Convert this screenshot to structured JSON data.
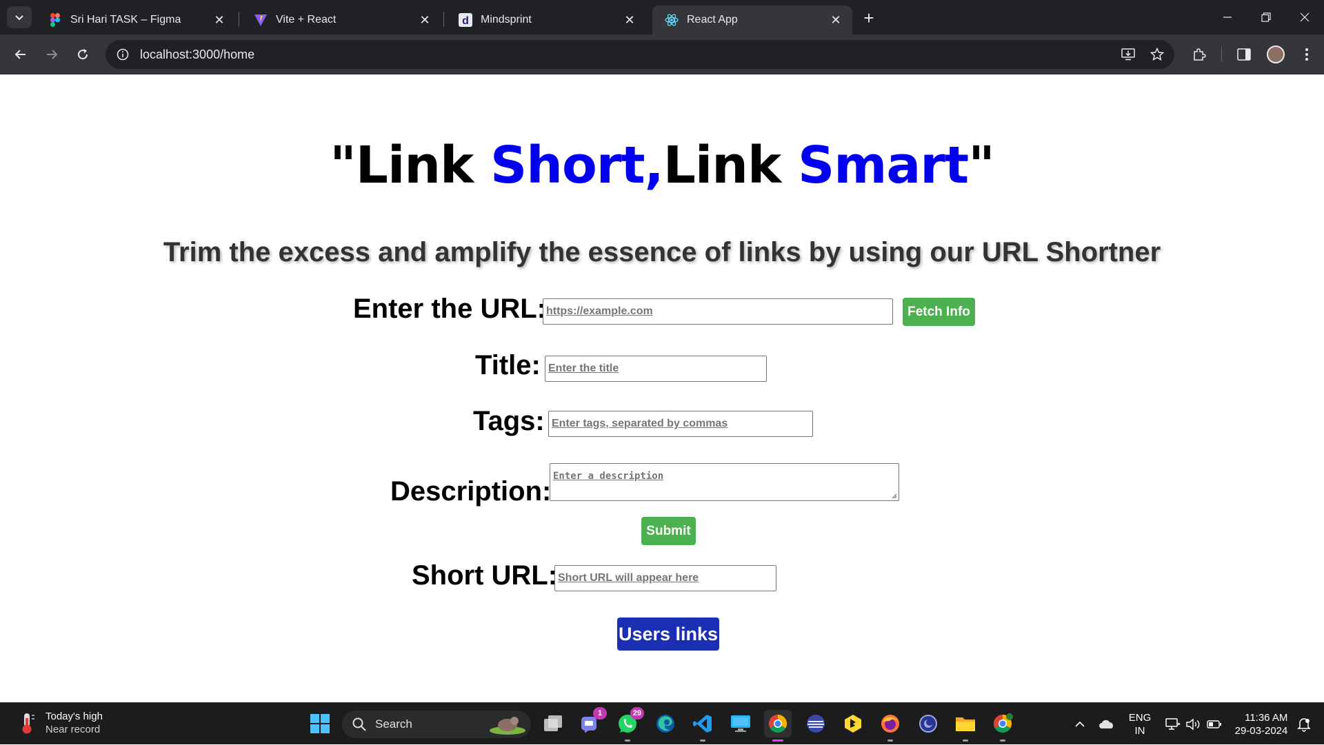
{
  "browser": {
    "tabs": [
      {
        "title": "Sri Hari TASK – Figma",
        "icon": "figma-icon",
        "active": false
      },
      {
        "title": "Vite + React",
        "icon": "vite-icon",
        "active": false
      },
      {
        "title": "Mindsprint",
        "icon": "mindsprint-icon",
        "active": false
      },
      {
        "title": "React App",
        "icon": "react-icon",
        "active": true
      }
    ],
    "address": "localhost:3000/home"
  },
  "page": {
    "headline": {
      "part1": "\"Link ",
      "part2": "Short,",
      "part3": "Link ",
      "part4": "Smart",
      "part5": "\""
    },
    "subheading": "Trim the excess and amplify the essence of links by using our URL Shortner",
    "form": {
      "url_label": "Enter the URL:",
      "url_placeholder": "https://example.com",
      "fetch_button": "Fetch Info",
      "title_label": "Title:",
      "title_placeholder": "Enter the title",
      "tags_label": "Tags:",
      "tags_placeholder": "Enter tags, separated by commas",
      "description_label": "Description:",
      "description_placeholder": "Enter a description",
      "submit_button": "Submit",
      "short_url_label": "Short URL:",
      "short_url_placeholder": "Short URL will appear here",
      "users_links_button": "Users links"
    },
    "colors": {
      "accent_blue": "#0000ee",
      "green_button": "#4caf50",
      "blue_button": "#1a2fb3"
    }
  },
  "taskbar": {
    "weather_line1": "Today's high",
    "weather_line2": "Near record",
    "search_label": "Search",
    "teams_badge": "1",
    "whatsapp_badge": "29",
    "language_line1": "ENG",
    "language_line2": "IN",
    "time": "11:36 AM",
    "date": "29-03-2024"
  }
}
